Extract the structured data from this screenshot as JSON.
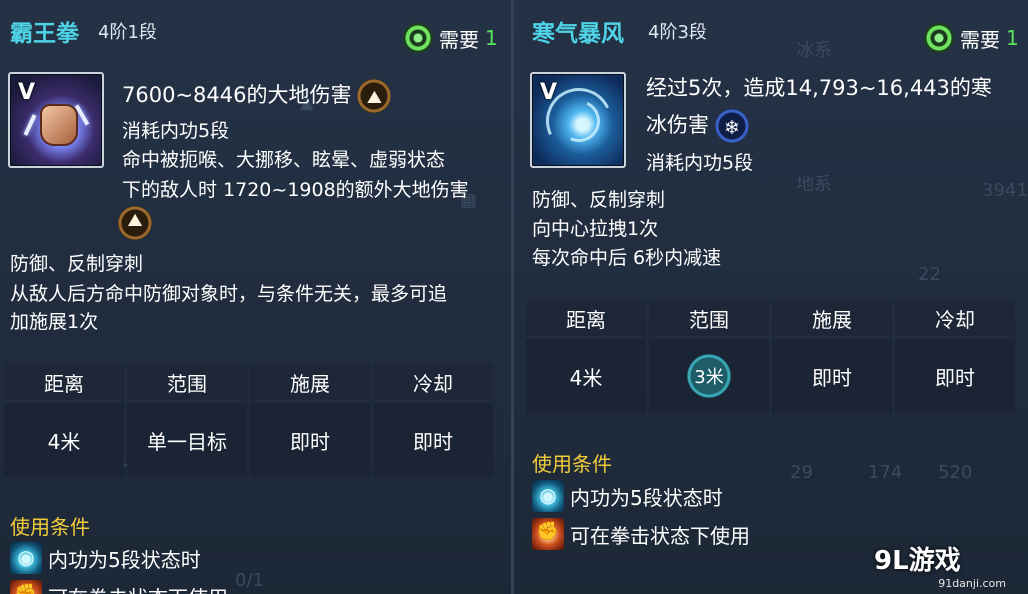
{
  "panels": [
    {
      "title": "霸王拳",
      "tier": "4阶1段",
      "requirement": {
        "label": "需要",
        "value": "1"
      },
      "description": {
        "damage": "7600~8446的大地伤害",
        "cost": "消耗内功5段",
        "bonus_line1": "命中被扼喉、大挪移、眩晕、虚弱状态",
        "bonus_line2": "下的敌人时 1720~1908的额外大地伤害",
        "effect1": "防御、反制穿刺",
        "effect2": "从敌人后方命中防御对象时，与条件无关，最多可追",
        "effect3": "加施展1次"
      },
      "stats": {
        "headers": [
          "距离",
          "范围",
          "施展",
          "冷却"
        ],
        "values": [
          "4米",
          "单一目标",
          "即时",
          "即时"
        ]
      },
      "conditions": {
        "title": "使用条件",
        "items": [
          "内功为5段状态时",
          "可在拳击状态下使用"
        ]
      }
    },
    {
      "title": "寒气暴风",
      "tier": "4阶3段",
      "requirement": {
        "label": "需要",
        "value": "1"
      },
      "description": {
        "damage_line1": "经过5次，造成14,793~16,443的寒",
        "damage_line2": "冰伤害",
        "cost": "消耗内功5段",
        "effect1": "防御、反制穿刺",
        "effect2": "向中心拉拽1次",
        "effect3": "每次命中后 6秒内减速"
      },
      "stats": {
        "headers": [
          "距离",
          "范围",
          "施展",
          "冷却"
        ],
        "values": [
          "4米",
          "3米",
          "即时",
          "即时"
        ]
      },
      "conditions": {
        "title": "使用条件",
        "items": [
          "内功为5段状态时",
          "可在拳击状态下使用"
        ]
      }
    }
  ],
  "background_ghost_text": [
    "冰系",
    "地系",
    "3941",
    "22",
    "0/1",
    "0/1",
    "29",
    "174",
    "520"
  ],
  "watermark": {
    "logo": "9L游戏",
    "url": "91danji.com"
  },
  "colors": {
    "title": "#4fd3e6",
    "condition_title": "#f2cc3a",
    "requirement_value": "#58e35b"
  }
}
